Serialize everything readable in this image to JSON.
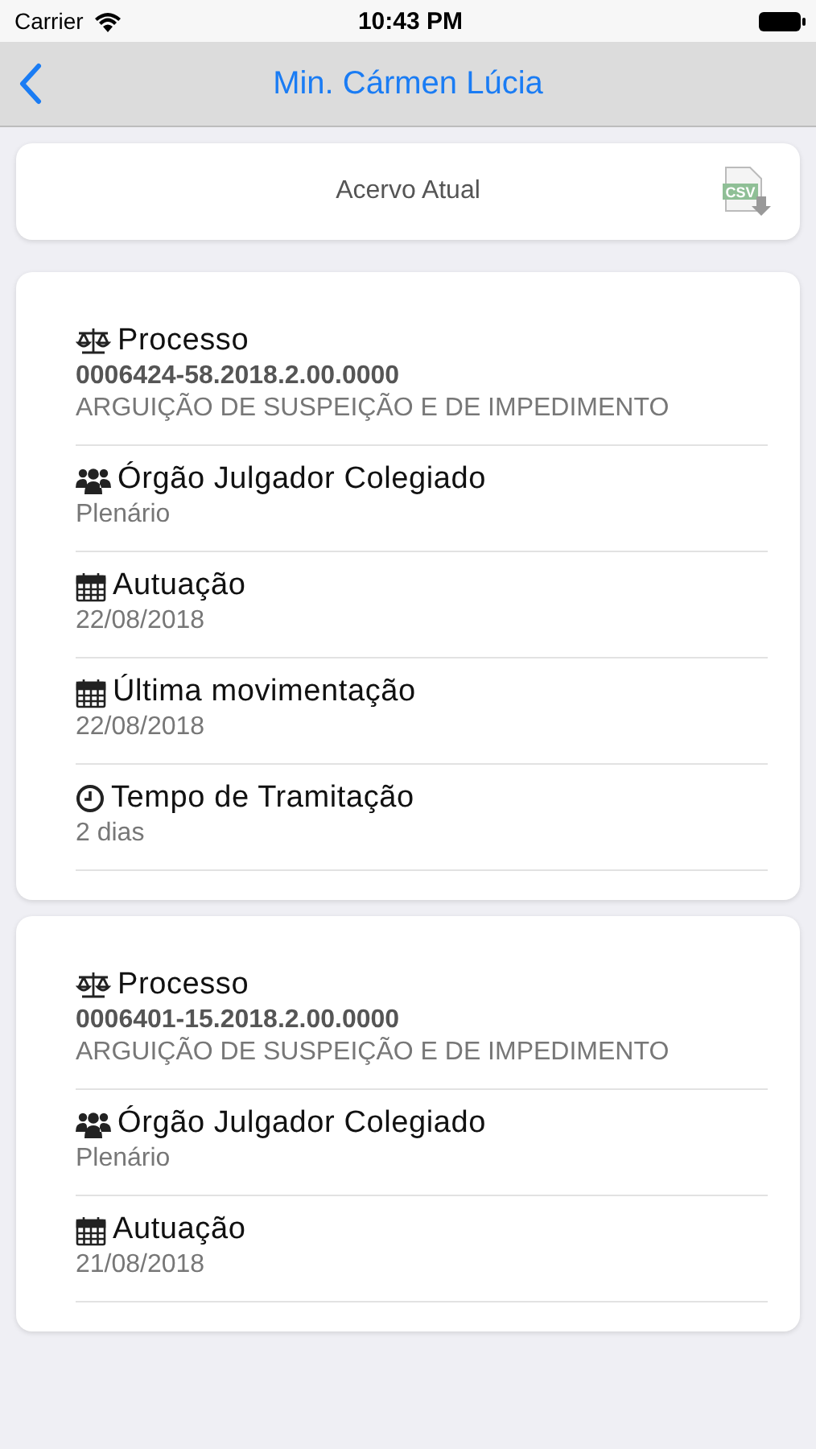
{
  "status_bar": {
    "carrier": "Carrier",
    "time": "10:43 PM"
  },
  "nav_bar": {
    "title": "Min. Cármen Lúcia"
  },
  "header_card": {
    "title": "Acervo Atual",
    "export_label": "CSV"
  },
  "cards": [
    {
      "fields": [
        {
          "kind": "scales",
          "label": "Processo",
          "number": "0006424-58.2018.2.00.0000",
          "value": "ARGUIÇÃO DE SUSPEIÇÃO E DE IMPEDIMENTO"
        },
        {
          "kind": "group",
          "label": "Órgão Julgador Colegiado",
          "value": "Plenário"
        },
        {
          "kind": "calendar",
          "label": "Autuação",
          "value": "22/08/2018"
        },
        {
          "kind": "calendar",
          "label": "Última movimentação",
          "value": "22/08/2018"
        },
        {
          "kind": "clock",
          "label": "Tempo de Tramitação",
          "value": "2 dias"
        }
      ]
    },
    {
      "fields": [
        {
          "kind": "scales",
          "label": "Processo",
          "number": "0006401-15.2018.2.00.0000",
          "value": "ARGUIÇÃO DE SUSPEIÇÃO E DE IMPEDIMENTO"
        },
        {
          "kind": "group",
          "label": "Órgão Julgador Colegiado",
          "value": "Plenário"
        },
        {
          "kind": "calendar",
          "label": "Autuação",
          "value": "21/08/2018"
        }
      ]
    }
  ]
}
